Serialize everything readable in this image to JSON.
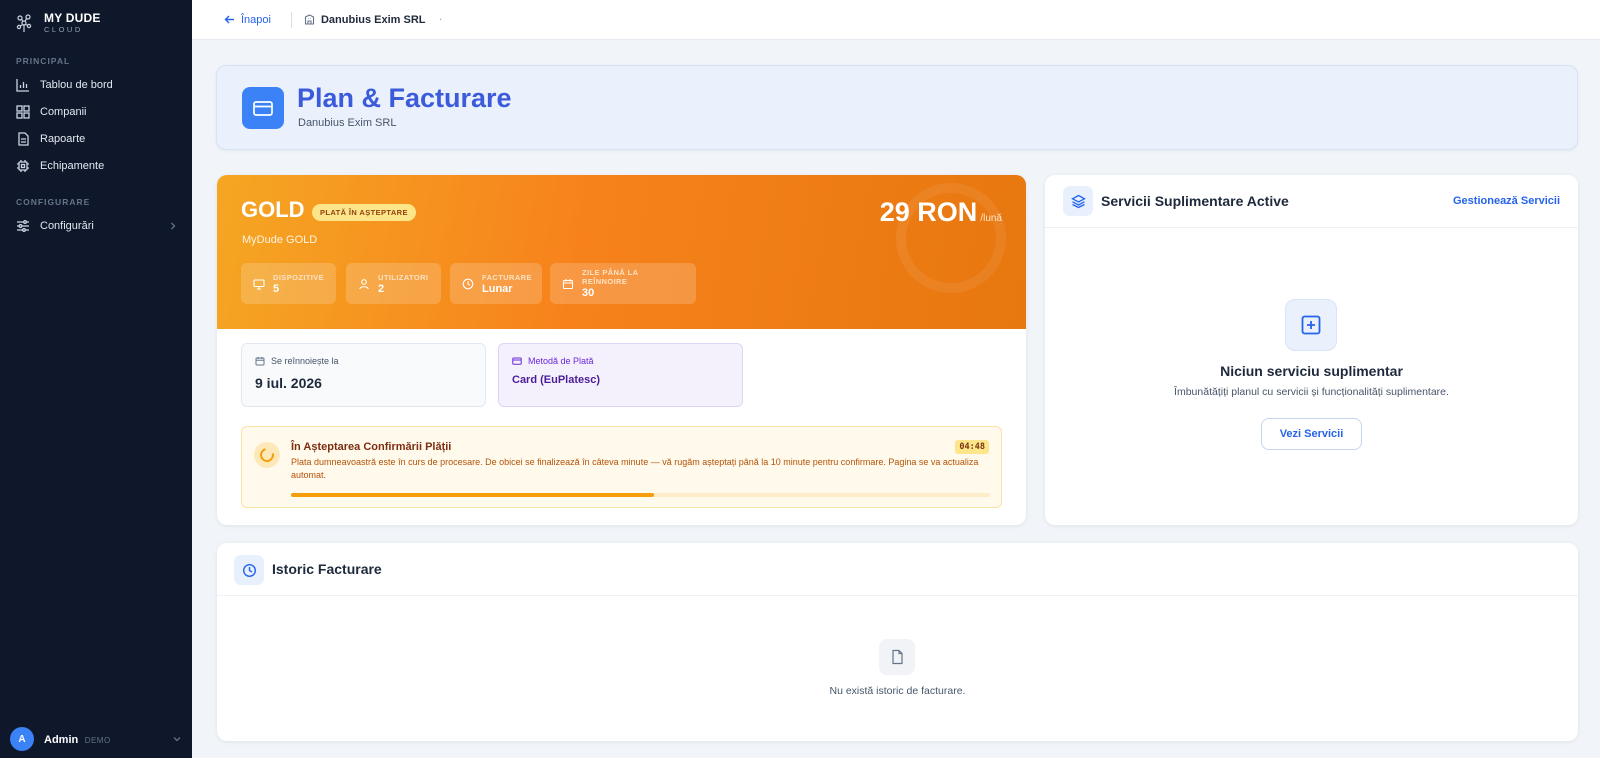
{
  "brand": {
    "name": "MY DUDE",
    "sub": "CLOUD"
  },
  "sidebar": {
    "sections": [
      {
        "title": "PRINCIPAL"
      },
      {
        "title": "CONFIGURARE"
      }
    ],
    "items": [
      {
        "label": "Tablou de bord",
        "icon": "bar-chart-icon"
      },
      {
        "label": "Companii",
        "icon": "grid-icon"
      },
      {
        "label": "Rapoarte",
        "icon": "file-icon"
      },
      {
        "label": "Echipamente",
        "icon": "chip-icon"
      },
      {
        "label": "Configurări",
        "icon": "sliders-icon"
      }
    ]
  },
  "user": {
    "initial": "A",
    "name": "Admin",
    "role": "DEMO"
  },
  "topbar": {
    "back_label": "Înapoi",
    "company": "Danubius Exim SRL",
    "dot": "·"
  },
  "header": {
    "title": "Plan & Facturare",
    "subtitle": "Danubius Exim SRL"
  },
  "plan": {
    "name": "GOLD",
    "badge": "PLATĂ ÎN AȘTEPTARE",
    "subtitle": "MyDude GOLD",
    "price": "29 RON",
    "period": "/lună",
    "stats": [
      {
        "label": "DISPOZITIVE",
        "value": "5"
      },
      {
        "label": "UTILIZATORI",
        "value": "2"
      },
      {
        "label": "FACTURARE",
        "value": "Lunar"
      },
      {
        "label": "ZILE PÂNĂ LA REÎNNOIRE",
        "value": "30"
      }
    ],
    "renewal": {
      "label": "Se reînnoiește la",
      "value": "9 iul. 2026"
    },
    "payment": {
      "label": "Metodă de Plată",
      "value": "Card (EuPlatesc)"
    },
    "pending": {
      "title": "În Așteptarea Confirmării Plății",
      "text": "Plata dumneavoastră este în curs de procesare. De obicei se finalizează în câteva minute — vă rugăm așteptați până la 10 minute pentru confirmare. Pagina se va actualiza automat.",
      "timer": "04:48",
      "progress": 0.52
    },
    "colors": {
      "hero_start": "#f5a623",
      "hero_end": "#e7770f"
    }
  },
  "services": {
    "title": "Servicii Suplimentare Active",
    "manage_link": "Gestionează Servicii",
    "empty_title": "Niciun serviciu suplimentar",
    "empty_sub": "Îmbunătățiți planul cu servicii și funcționalități suplimentare.",
    "button": "Vezi Servicii"
  },
  "history": {
    "title": "Istoric Facturare",
    "empty": "Nu există istoric de facturare."
  }
}
